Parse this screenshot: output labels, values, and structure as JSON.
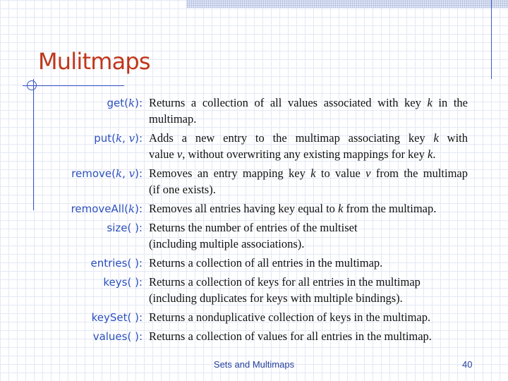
{
  "slide": {
    "title": "Mulitmaps",
    "footer_title": "Sets and Multimaps",
    "page_number": "40"
  },
  "methods": [
    {
      "label": "get(k):",
      "description": "Returns a collection of all values associated with key k in the multimap."
    },
    {
      "label": "put(k, v):",
      "description": "Adds a new entry to the multimap associating key k with value v, without overwriting any existing mappings for key k."
    },
    {
      "label": "remove(k, v):",
      "description": "Removes an entry mapping key k to value v from the multimap (if one exists)."
    },
    {
      "label": "removeAll(k):",
      "description": "Removes all entries having key equal to k from the multimap."
    },
    {
      "label": "size( ):",
      "description": "Returns the number of entries of the multiset (including multiple associations)."
    },
    {
      "label": "entries( ):",
      "description": "Returns a collection of all entries in the multimap."
    },
    {
      "label": "keys( ):",
      "description": "Returns a collection of keys for all entries in the multimap (including duplicates for keys with multiple bindings)."
    },
    {
      "label": "keySet( ):",
      "description": "Returns a nonduplicative collection of keys in the multimap."
    },
    {
      "label": "values( ):",
      "description": "Returns a collection of values for all entries in the multimap."
    }
  ],
  "colors": {
    "title": "#c0361b",
    "method_label": "#2b4fbd",
    "rule_lines": "#3b57c6",
    "footer": "#233f9c"
  }
}
